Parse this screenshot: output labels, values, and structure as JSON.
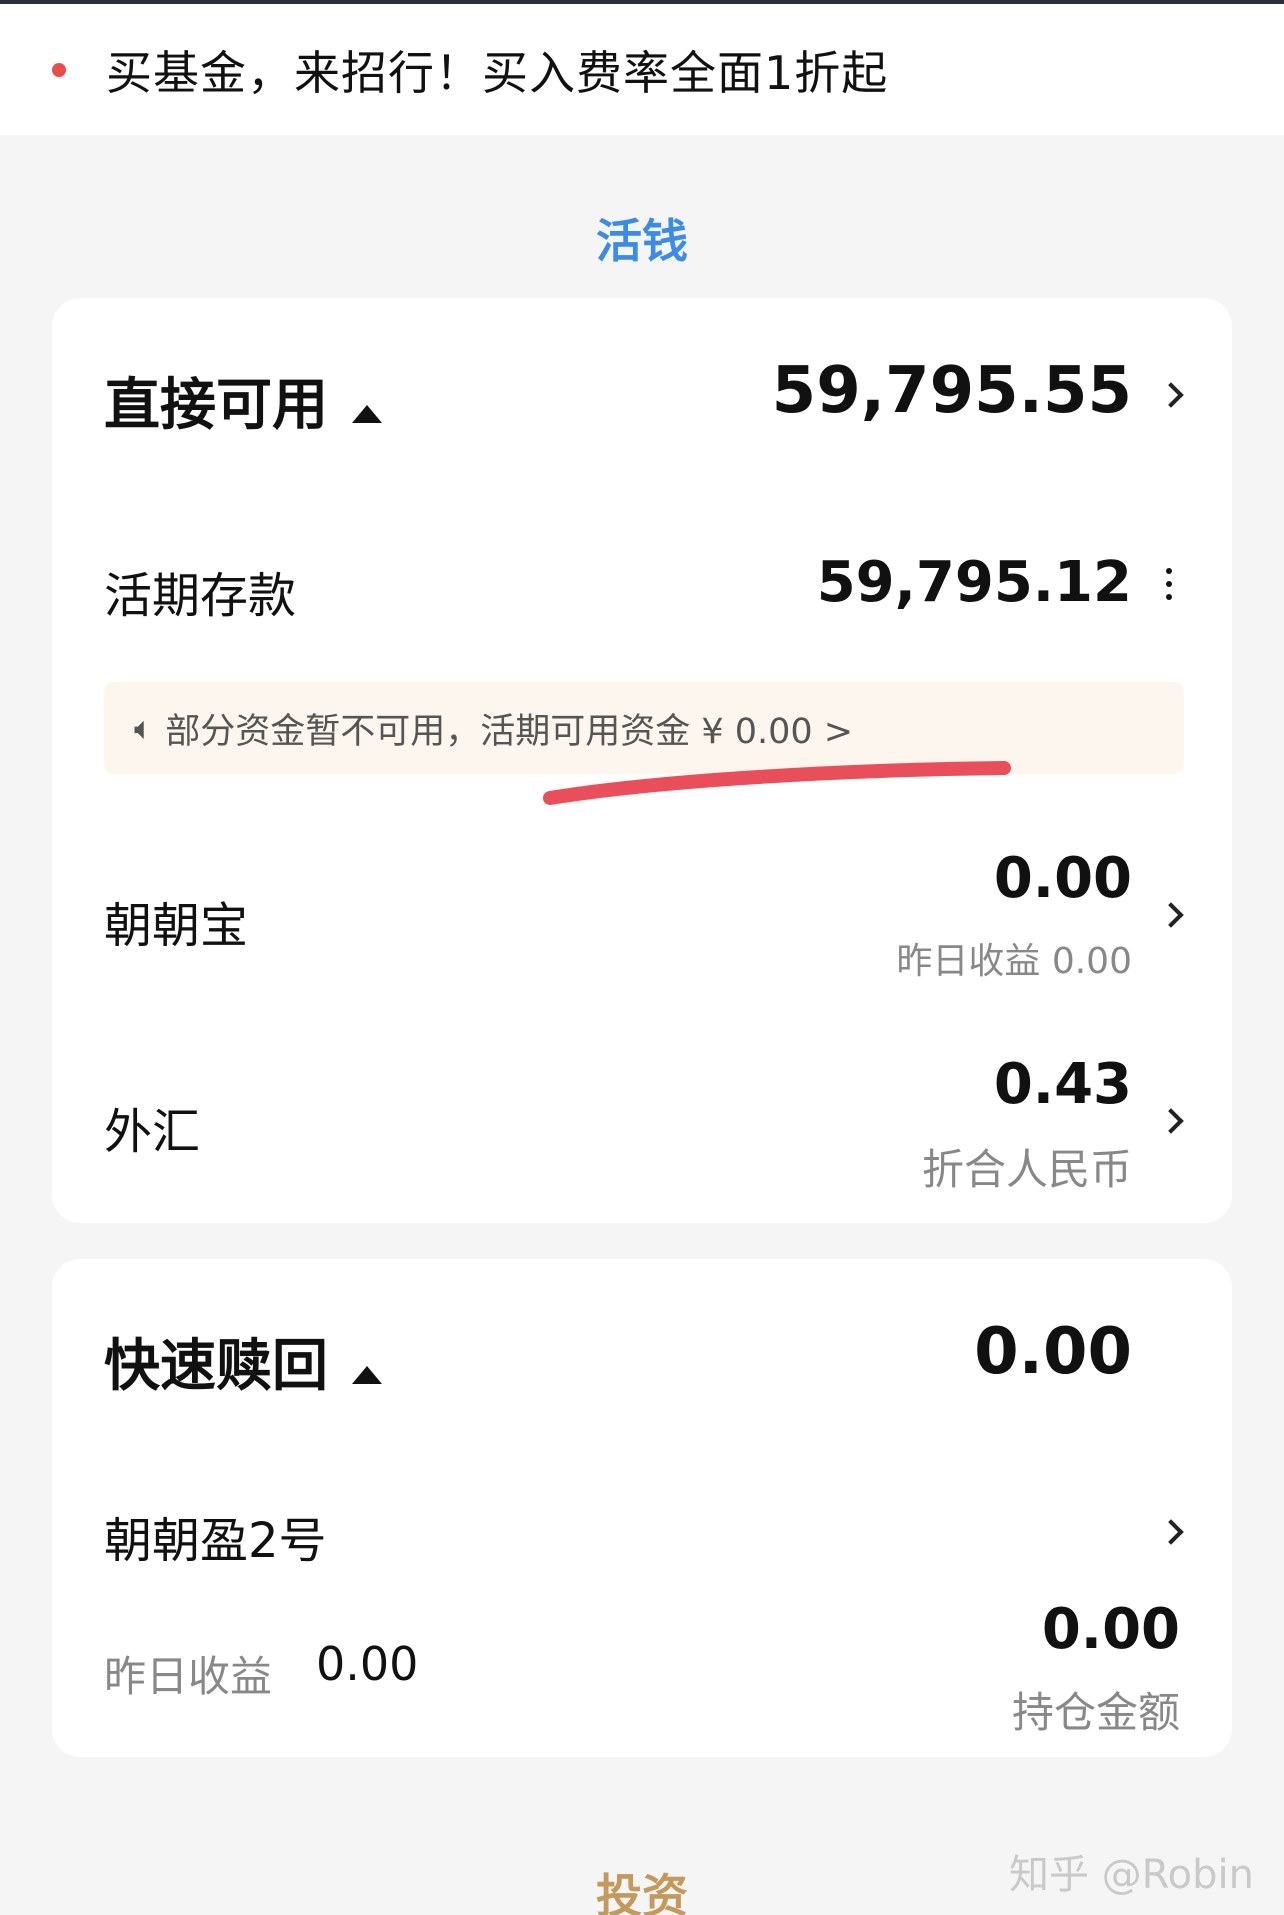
{
  "banner": {
    "text": "买基金，来招行！买入费率全面1折起"
  },
  "sections": {
    "cash_title": "活钱",
    "invest_title": "投资"
  },
  "direct": {
    "title": "直接可用",
    "amount": "59,795.55",
    "demand_label": "活期存款",
    "demand_amount": "59,795.12",
    "notice": "部分资金暂不可用，活期可用资金 ¥ 0.00 >",
    "zzb_label": "朝朝宝",
    "zzb_amount": "0.00",
    "zzb_sub": "昨日收益 0.00",
    "fx_label": "外汇",
    "fx_amount": "0.43",
    "fx_sub": "折合人民币"
  },
  "quick": {
    "title": "快速赎回",
    "amount": "0.00",
    "product_label": "朝朝盈2号",
    "yesterday_label": "昨日收益",
    "yesterday_value": "0.00",
    "hold_amount": "0.00",
    "hold_label": "持仓金额"
  },
  "watermark": "知乎 @Robin",
  "colors": {
    "cash_title": "#3c8be6",
    "invest_title": "#c39a5c",
    "banner_dot": "#e84c4c",
    "underline": "#e94f5a"
  }
}
